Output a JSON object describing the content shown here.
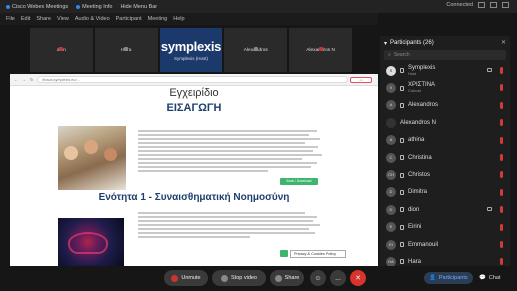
{
  "titlebar": {
    "app": "Cisco Webex Meetings",
    "meeting_info": "Meeting Info",
    "hide_menu": "Hide Menu Bar",
    "connected": "Connected"
  },
  "menu": [
    "File",
    "Edit",
    "Share",
    "View",
    "Audio & Video",
    "Participant",
    "Meeting",
    "Help"
  ],
  "video_strip": [
    {
      "name": "dion"
    },
    {
      "name": "Hara"
    },
    {
      "brand": "symplexis",
      "name": "Symplexis (Host)"
    },
    {
      "name": "Alexandros"
    },
    {
      "name": "Alexandros N"
    }
  ],
  "shared_screen": {
    "address": "ithaca.symplexis.eu/...",
    "heading_small": "Εγχειρίδιο",
    "heading_intro": "ΕΙΣΑΓΩΓΗ",
    "button1": "Book / Download",
    "heading_section": "Ενότητα 1 - Συναισθηματική Νοημοσύνη",
    "tooltip": "Privacy & Cookies Policy"
  },
  "participants": {
    "title": "Participants (26)",
    "search_placeholder": "Search",
    "list": [
      {
        "name": "Symplexis",
        "sub": "Host",
        "initials": "S"
      },
      {
        "name": "ΧΡΙΣΤΙΝΑ",
        "sub": "Cohost",
        "initials": "X"
      },
      {
        "name": "Alexandros",
        "initials": "A"
      },
      {
        "name": "Alexandros N",
        "initials": ""
      },
      {
        "name": "athina",
        "initials": "A"
      },
      {
        "name": "Christina",
        "initials": "C"
      },
      {
        "name": "Christos",
        "initials": "CH"
      },
      {
        "name": "Dimitra",
        "initials": "D"
      },
      {
        "name": "dion",
        "initials": "D"
      },
      {
        "name": "Eirini",
        "initials": "E"
      },
      {
        "name": "Emmanouil",
        "initials": "EI"
      },
      {
        "name": "Hara",
        "initials": "HA"
      }
    ]
  },
  "controls": {
    "unmute": "Unmute",
    "stop_video": "Stop video",
    "share": "Share",
    "more": "...",
    "end": "✕",
    "participants_tab": "Participants",
    "chat_tab": "Chat"
  },
  "colors": {
    "accent": "#2e8ae6",
    "mute_red": "#d03a3a",
    "end_red": "#d6342c",
    "brand_blue": "#1b3a6b"
  }
}
